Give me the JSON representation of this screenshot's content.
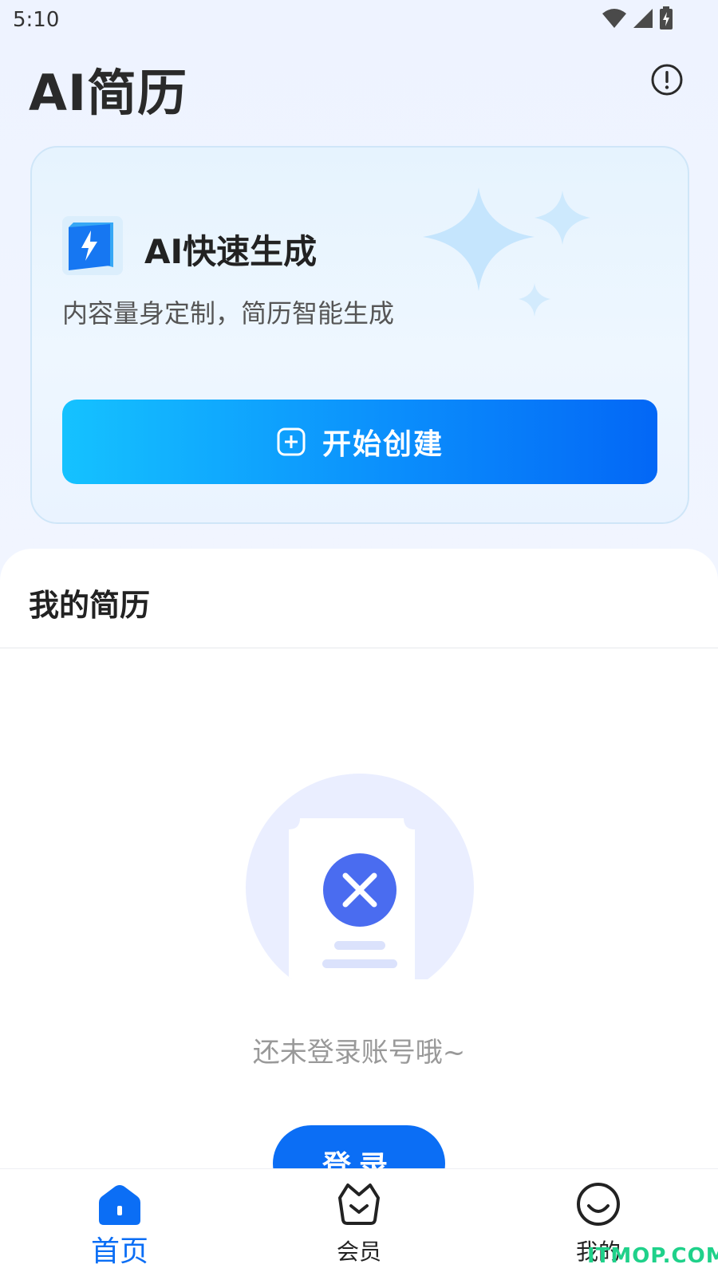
{
  "status_bar": {
    "time": "5:10"
  },
  "header": {
    "title": "AI简历"
  },
  "hero": {
    "title": "AI快速生成",
    "subtitle": "内容量身定制，简历智能生成",
    "button_label": "开始创建"
  },
  "my_resume": {
    "section_title": "我的简历",
    "empty_text": "还未登录账号哦~",
    "login_label": "登录"
  },
  "bottom_nav": {
    "items": [
      {
        "label": "首页",
        "icon": "home-icon",
        "active": true
      },
      {
        "label": "会员",
        "icon": "vip-basket-icon",
        "active": false
      },
      {
        "label": "我的",
        "icon": "smile-icon",
        "active": false
      }
    ]
  },
  "watermark": "ITMOP.COM",
  "colors": {
    "accent": "#0b6ef5",
    "gradient_start": "#15c2ff",
    "gradient_end": "#0367f6"
  }
}
